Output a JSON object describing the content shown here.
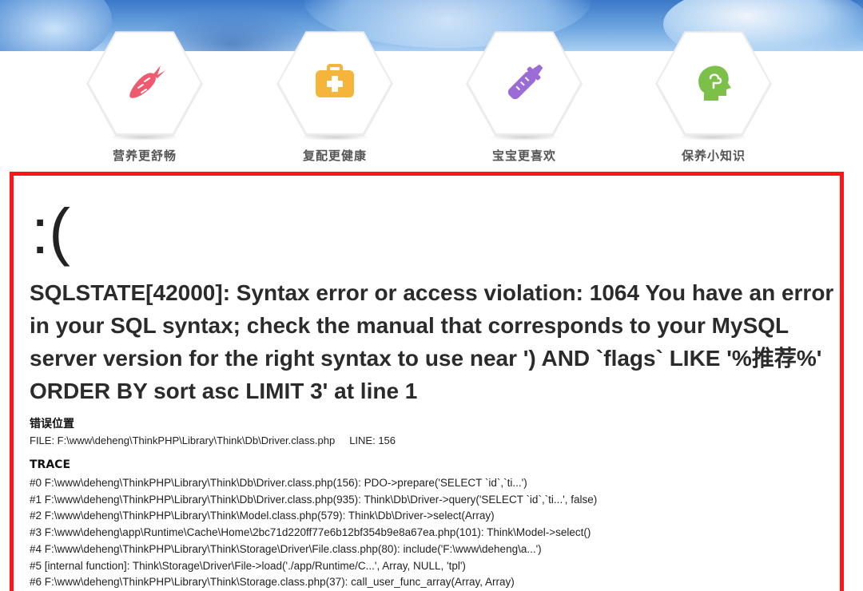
{
  "features": [
    {
      "label": "营养更舒畅",
      "icon": "carrot-icon",
      "color": "#f05a6e"
    },
    {
      "label": "复配更健康",
      "icon": "first-aid-kit-icon",
      "color": "#f5b53a"
    },
    {
      "label": "宝宝更喜欢",
      "icon": "baby-bottle-icon",
      "color": "#9b6bd6"
    },
    {
      "label": "保养小知识",
      "icon": "brain-head-icon",
      "color": "#7cc04a"
    }
  ],
  "error": {
    "face": ":(",
    "message": "SQLSTATE[42000]: Syntax error or access violation: 1064 You have an error in your SQL syntax; check the manual that corresponds to your MySQL server version for the right syntax to use near ') AND `flags` LIKE '%推荐%' ORDER BY sort asc LIMIT 3' at line 1",
    "location_title": "错误位置",
    "file": "FILE: F:\\www\\deheng\\ThinkPHP\\Library\\Think\\Db\\Driver.class.php",
    "line": "LINE: 156",
    "trace_title": "TRACE",
    "trace": [
      "#0 F:\\www\\deheng\\ThinkPHP\\Library\\Think\\Db\\Driver.class.php(156): PDO->prepare('SELECT `id`,`ti...')",
      "#1 F:\\www\\deheng\\ThinkPHP\\Library\\Think\\Db\\Driver.class.php(935): Think\\Db\\Driver->query('SELECT `id`,`ti...', false)",
      "#2 F:\\www\\deheng\\ThinkPHP\\Library\\Think\\Model.class.php(579): Think\\Db\\Driver->select(Array)",
      "#3 F:\\www\\deheng\\app\\Runtime\\Cache\\Home\\2bc71d220ff77e6b12bf354b9e8a67ea.php(101): Think\\Model->select()",
      "#4 F:\\www\\deheng\\ThinkPHP\\Library\\Think\\Storage\\Driver\\File.class.php(80): include('F:\\www\\deheng\\a...')",
      "#5 [internal function]: Think\\Storage\\Driver\\File->load('./app/Runtime/C...', Array, NULL, 'tpl')",
      "#6 F:\\www\\deheng\\ThinkPHP\\Library\\Think\\Storage.class.php(37): call_user_func_array(Array, Array)"
    ]
  },
  "colors": {
    "error_border": "#ff1515"
  }
}
